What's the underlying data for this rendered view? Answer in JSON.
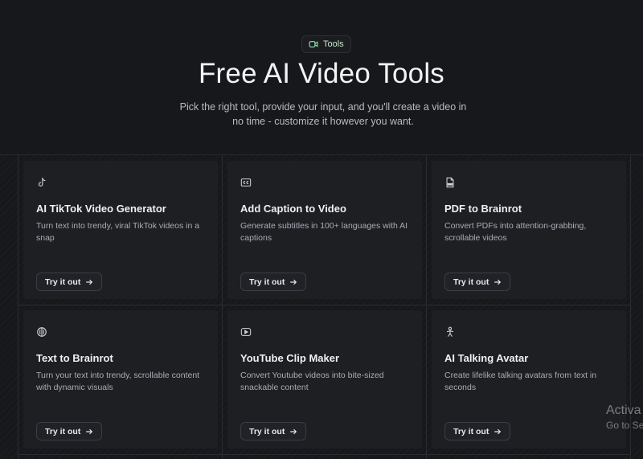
{
  "hero": {
    "badge_label": "Tools",
    "title": "Free AI Video Tools",
    "subtitle": "Pick the right tool, provide your input, and you'll create a video in no time - customize it however you want."
  },
  "cards": [
    {
      "icon": "tiktok-icon",
      "title": "AI TikTok Video Generator",
      "description": "Turn text into trendy, viral TikTok videos in a snap",
      "button": "Try it out"
    },
    {
      "icon": "closed-caption-icon",
      "title": "Add Caption to Video",
      "description": "Generate subtitles in 100+ languages with AI captions",
      "button": "Try it out"
    },
    {
      "icon": "pdf-file-icon",
      "title": "PDF to Brainrot",
      "description": "Convert PDFs into attention-grabbing, scrollable videos",
      "button": "Try it out"
    },
    {
      "icon": "brain-icon",
      "title": "Text to Brainrot",
      "description": "Turn your text into trendy, scrollable content with dynamic visuals",
      "button": "Try it out"
    },
    {
      "icon": "youtube-icon",
      "title": "YouTube Clip Maker",
      "description": "Convert Youtube videos into bite-sized snackable content",
      "button": "Try it out"
    },
    {
      "icon": "person-avatar-icon",
      "title": "AI Talking Avatar",
      "description": "Create lifelike talking avatars from text in seconds",
      "button": "Try it out"
    }
  ],
  "watermark": {
    "line1": "Activa",
    "line2": "Go to Se"
  },
  "colors": {
    "background": "#17181b",
    "card": "#1d1f23",
    "badge_text": "#c9e7d2"
  }
}
